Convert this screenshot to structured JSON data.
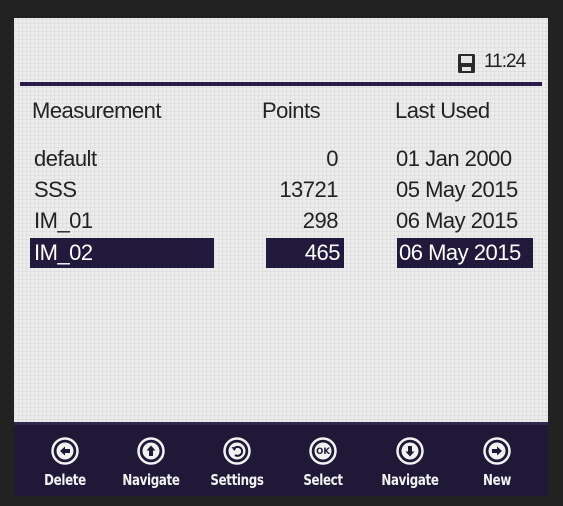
{
  "status": {
    "time": "11:24",
    "icon": "save-icon"
  },
  "table": {
    "headers": {
      "measurement": "Measurement",
      "points": "Points",
      "last_used": "Last Used"
    },
    "rows": [
      {
        "name": "default",
        "points": "0",
        "last_used": "01 Jan 2000",
        "selected": false
      },
      {
        "name": "SSS",
        "points": "13721",
        "last_used": "05 May 2015",
        "selected": false
      },
      {
        "name": "IM_01",
        "points": "298",
        "last_used": "06 May 2015",
        "selected": false
      },
      {
        "name": "IM_02",
        "points": "465",
        "last_used": "06 May 2015",
        "selected": true
      }
    ]
  },
  "softkeys": [
    {
      "label": "Delete",
      "icon": "arrow-left-icon"
    },
    {
      "label": "Navigate",
      "icon": "arrow-up-icon"
    },
    {
      "label": "Settings",
      "icon": "settings-back-icon"
    },
    {
      "label": "Select",
      "icon": "ok-icon",
      "icon_text": "OK"
    },
    {
      "label": "Navigate",
      "icon": "arrow-down-icon"
    },
    {
      "label": "New",
      "icon": "arrow-right-icon"
    }
  ],
  "colors": {
    "selection": "#221a3c",
    "bar": "#1f1836",
    "screen": "#ececec"
  }
}
